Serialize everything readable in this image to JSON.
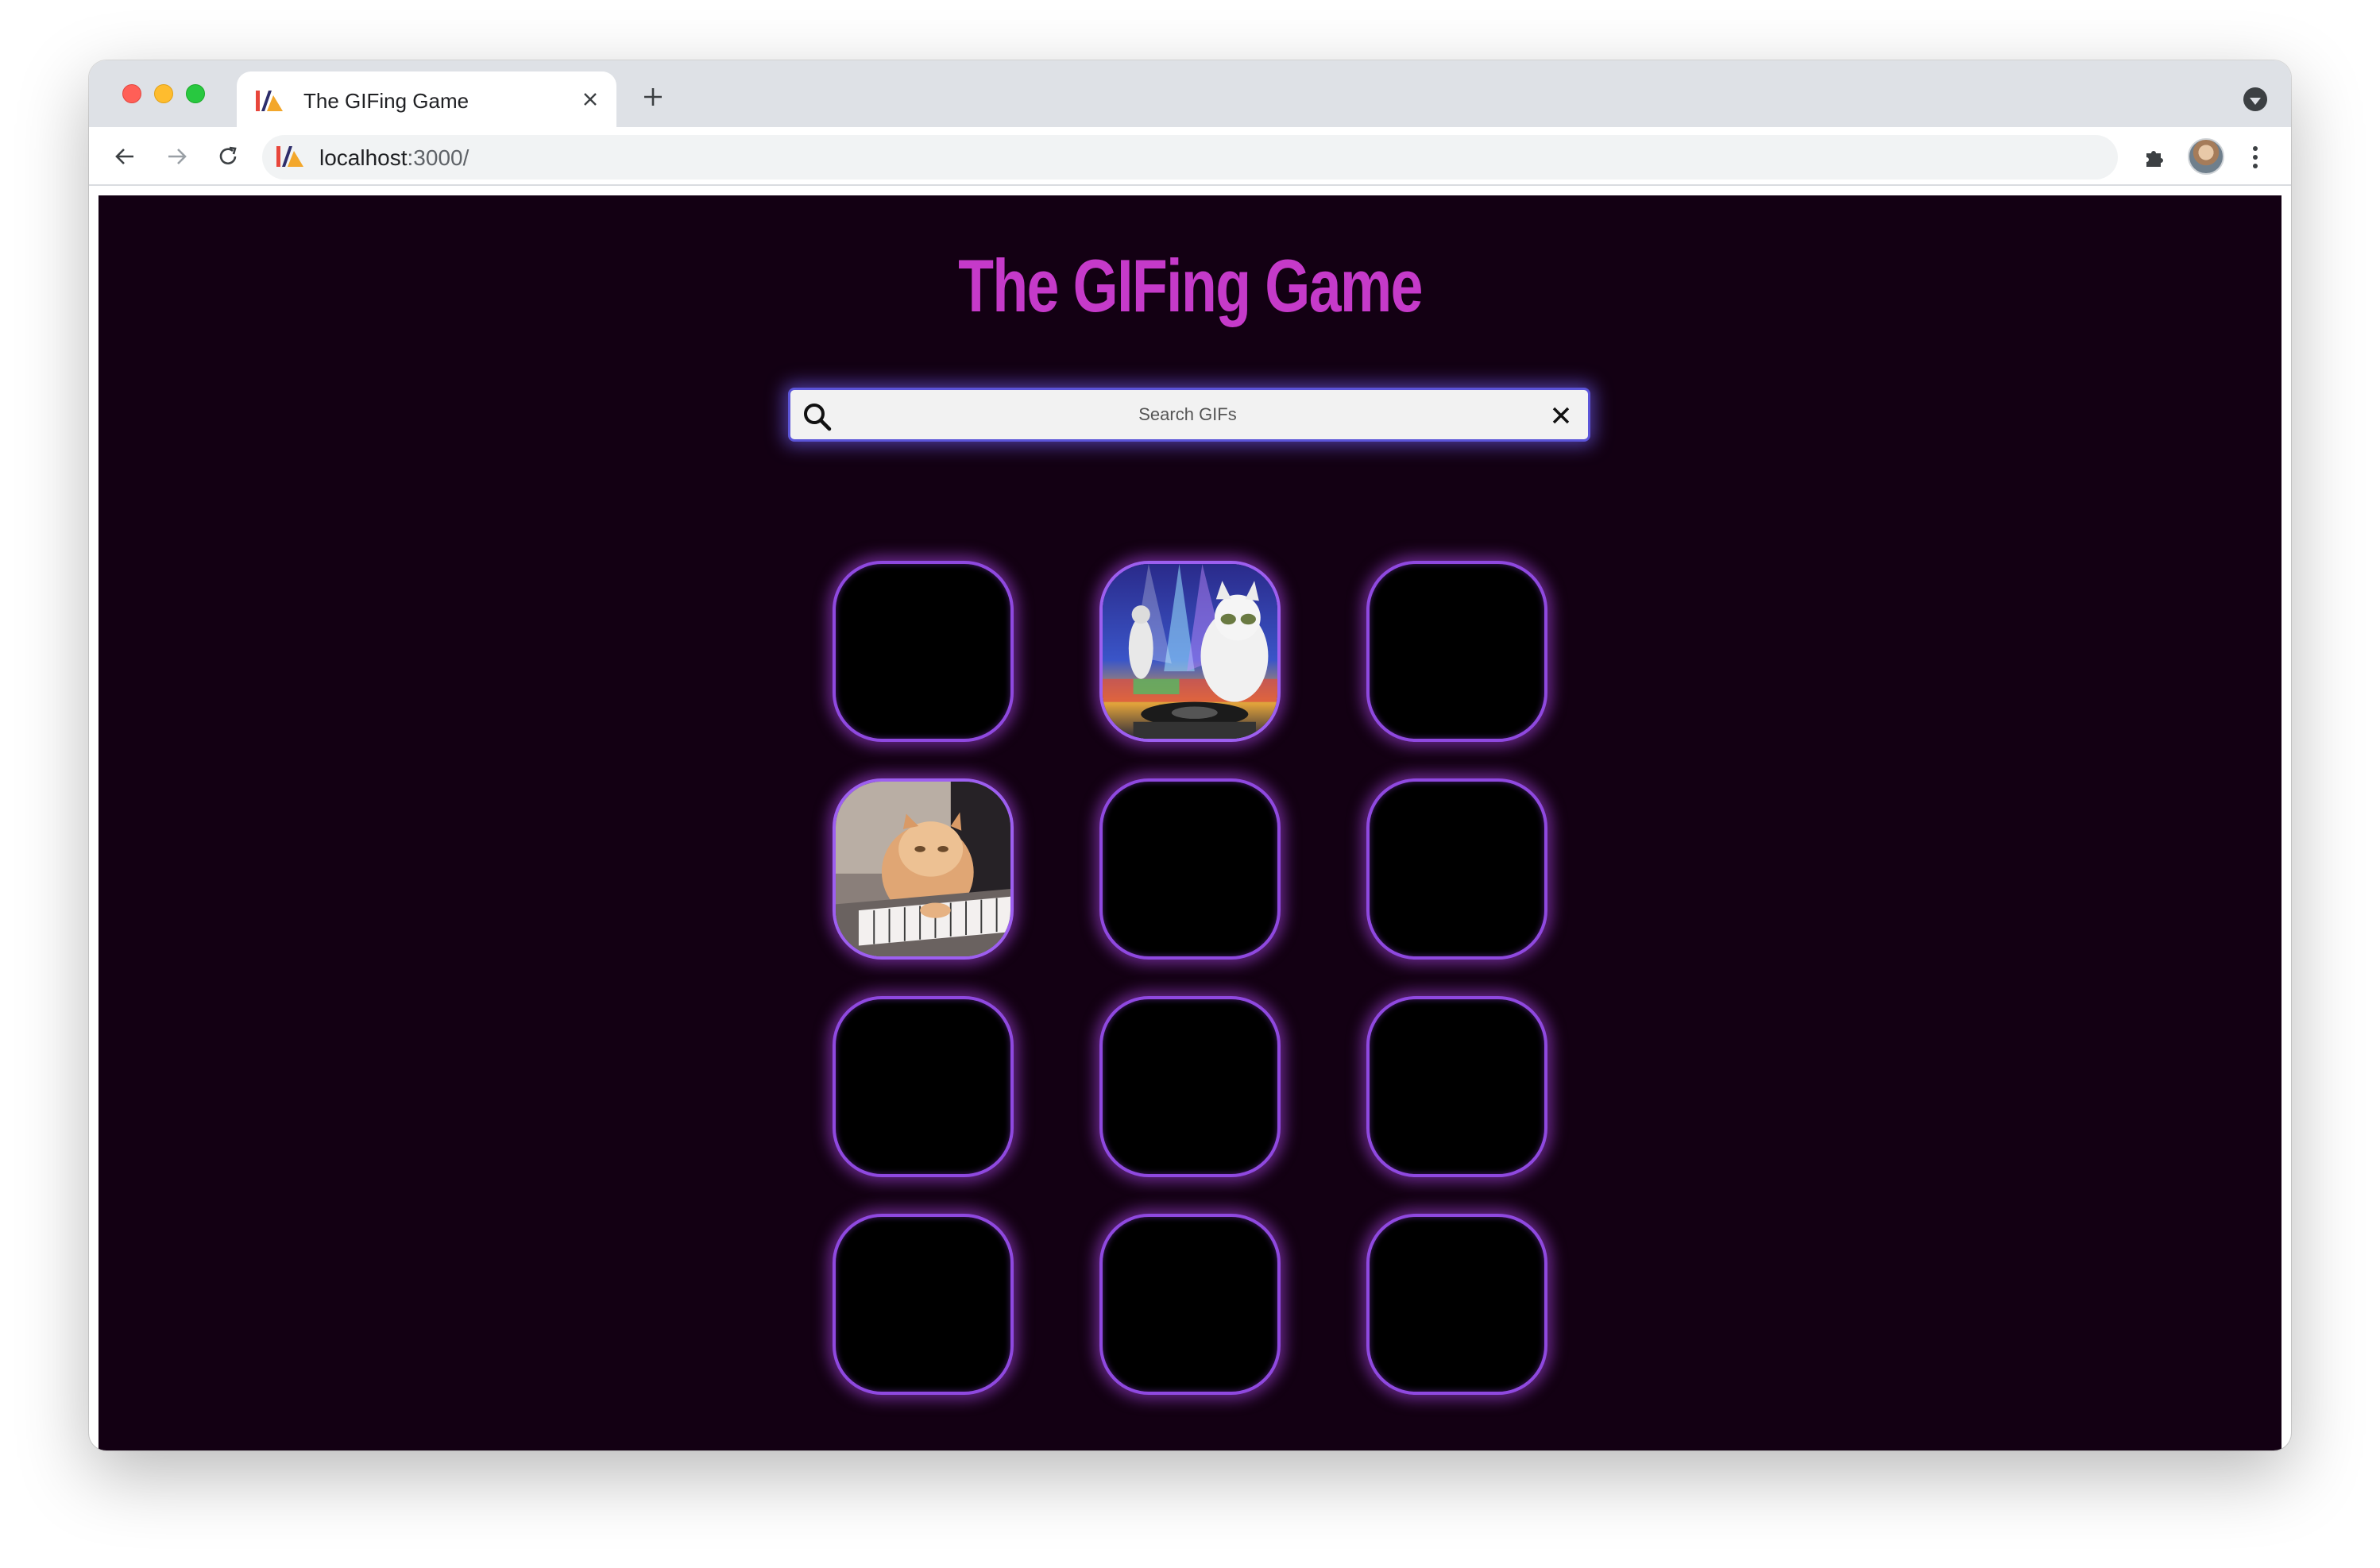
{
  "browser": {
    "tab_title": "The GIFing Game",
    "tab_close_icon": "close-icon",
    "new_tab_icon": "plus-icon",
    "url_host": "localhost",
    "url_path": ":3000/"
  },
  "page": {
    "title": "The GIFing Game",
    "search": {
      "placeholder": "Search GIFs",
      "value": ""
    }
  },
  "colors": {
    "background": "#130013",
    "title": "#c53ac9",
    "card_border": "#8f49e0",
    "search_glow": "#5b54d8"
  },
  "cards": [
    {
      "state": "hidden"
    },
    {
      "state": "revealed",
      "image": "dj-cats-gif"
    },
    {
      "state": "hidden"
    },
    {
      "state": "revealed",
      "image": "keyboard-cat-gif"
    },
    {
      "state": "hidden"
    },
    {
      "state": "hidden"
    },
    {
      "state": "hidden"
    },
    {
      "state": "hidden"
    },
    {
      "state": "hidden"
    },
    {
      "state": "hidden"
    },
    {
      "state": "hidden"
    },
    {
      "state": "hidden"
    }
  ]
}
